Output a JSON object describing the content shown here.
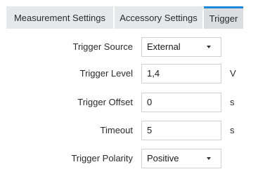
{
  "tabs": [
    {
      "label": "Measurement Settings",
      "active": false
    },
    {
      "label": "Accessory Settings",
      "active": false
    },
    {
      "label": "Trigger",
      "active": true
    }
  ],
  "form": {
    "trigger_source": {
      "label": "Trigger Source",
      "value": "External"
    },
    "trigger_level": {
      "label": "Trigger Level",
      "value": "1,4",
      "unit": "V"
    },
    "trigger_offset": {
      "label": "Trigger Offset",
      "value": "0",
      "unit": "s"
    },
    "timeout": {
      "label": "Timeout",
      "value": "5",
      "unit": "s"
    },
    "trigger_polarity": {
      "label": "Trigger Polarity",
      "value": "Positive"
    }
  },
  "colors": {
    "accent": "#1c8ad9",
    "tab_bg": "#e7e8ea",
    "field_border": "#cfd2d6"
  },
  "icons": {
    "dropdown_caret": "chevron-down-icon"
  }
}
